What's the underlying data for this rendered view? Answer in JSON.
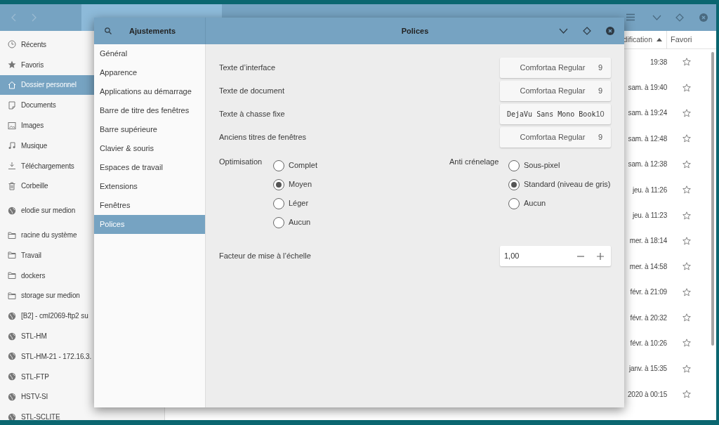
{
  "file_manager": {
    "sidebar": {
      "sections": [
        {
          "items": [
            {
              "kind": "clock",
              "label": "Récents",
              "selected": false
            },
            {
              "kind": "star",
              "label": "Favoris",
              "selected": false
            },
            {
              "kind": "home",
              "label": "Dossier personnel",
              "selected": true
            },
            {
              "kind": "document",
              "label": "Documents",
              "selected": false
            },
            {
              "kind": "image",
              "label": "Images",
              "selected": false
            },
            {
              "kind": "music",
              "label": "Musique",
              "selected": false
            },
            {
              "kind": "download",
              "label": "Téléchargements",
              "selected": false
            },
            {
              "kind": "trash",
              "label": "Corbeille",
              "selected": false
            }
          ]
        },
        {
          "items": [
            {
              "kind": "network",
              "label": "elodie sur medion",
              "selected": false
            }
          ]
        },
        {
          "items": [
            {
              "kind": "folder",
              "label": "racine du système",
              "selected": false
            },
            {
              "kind": "folder",
              "label": "Travail",
              "selected": false
            },
            {
              "kind": "folder",
              "label": "dockers",
              "selected": false
            },
            {
              "kind": "folder",
              "label": "storage sur medion",
              "selected": false
            },
            {
              "kind": "network",
              "label": "[B2] - cml2069-ftp2 su",
              "selected": false
            },
            {
              "kind": "network",
              "label": "STL-HM",
              "selected": false
            },
            {
              "kind": "network",
              "label": "STL-HM-21 - 172.16.3.",
              "selected": false
            },
            {
              "kind": "network",
              "label": "STL-FTP",
              "selected": false
            },
            {
              "kind": "network",
              "label": "HSTV-SI",
              "selected": false
            },
            {
              "kind": "network",
              "label": "STL-SCLITE",
              "selected": false
            }
          ]
        }
      ]
    },
    "columns": [
      {
        "label": "dification",
        "sorted": true
      },
      {
        "label": "Favori",
        "sorted": false
      }
    ],
    "rows": [
      {
        "modified": "19:38",
        "favorite": false
      },
      {
        "modified": "sam. à 19:40",
        "favorite": false
      },
      {
        "modified": "sam. à 19:24",
        "favorite": false
      },
      {
        "modified": "sam. à 12:48",
        "favorite": false
      },
      {
        "modified": "sam. à 12:38",
        "favorite": false
      },
      {
        "modified": "jeu. à 11:26",
        "favorite": false
      },
      {
        "modified": "jeu. à 11:23",
        "favorite": false
      },
      {
        "modified": "mer. à 18:14",
        "favorite": false
      },
      {
        "modified": "mer. à 14:58",
        "favorite": false
      },
      {
        "modified": "févr. à 21:09",
        "favorite": false
      },
      {
        "modified": "févr. à 20:32",
        "favorite": false
      },
      {
        "modified": "févr. à 10:26",
        "favorite": false
      },
      {
        "modified": "janv. à 15:35",
        "favorite": false
      },
      {
        "modified": "2020 à 00:15",
        "favorite": false
      }
    ]
  },
  "dialog": {
    "title": "Ajustements",
    "panel_title": "Polices",
    "nav": [
      {
        "label": "Général",
        "selected": false
      },
      {
        "label": "Apparence",
        "selected": false
      },
      {
        "label": "Applications au démarrage",
        "selected": false
      },
      {
        "label": "Barre de titre des fenêtres",
        "selected": false
      },
      {
        "label": "Barre supérieure",
        "selected": false
      },
      {
        "label": "Clavier & souris",
        "selected": false
      },
      {
        "label": "Espaces de travail",
        "selected": false
      },
      {
        "label": "Extensions",
        "selected": false
      },
      {
        "label": "Fenêtres",
        "selected": false
      },
      {
        "label": "Polices",
        "selected": true
      }
    ],
    "fonts": [
      {
        "label": "Texte d’interface",
        "kind": "proportional",
        "font": "Comfortaa Regular",
        "size": "9"
      },
      {
        "label": "Texte de document",
        "kind": "proportional",
        "font": "Comfortaa Regular",
        "size": "9"
      },
      {
        "label": "Texte à chasse fixe",
        "kind": "mono",
        "font": "DejaVu Sans Mono Book",
        "size": "10"
      },
      {
        "label": "Anciens titres de fenêtres",
        "kind": "proportional",
        "font": "Comfortaa Regular",
        "size": "9"
      }
    ],
    "radio_groups": [
      {
        "label": "Optimisation",
        "options": [
          {
            "label": "Complet",
            "selected": false
          },
          {
            "label": "Moyen",
            "selected": true
          },
          {
            "label": "Léger",
            "selected": false
          },
          {
            "label": "Aucun",
            "selected": false
          }
        ]
      },
      {
        "label": "Anti crénelage",
        "options": [
          {
            "label": "Sous-pixel",
            "selected": false
          },
          {
            "label": "Standard (niveau de gris)",
            "selected": true
          },
          {
            "label": "Aucun",
            "selected": false
          }
        ]
      }
    ],
    "scale": {
      "label": "Facteur de mise à l’échelle",
      "value": "1,00"
    }
  }
}
